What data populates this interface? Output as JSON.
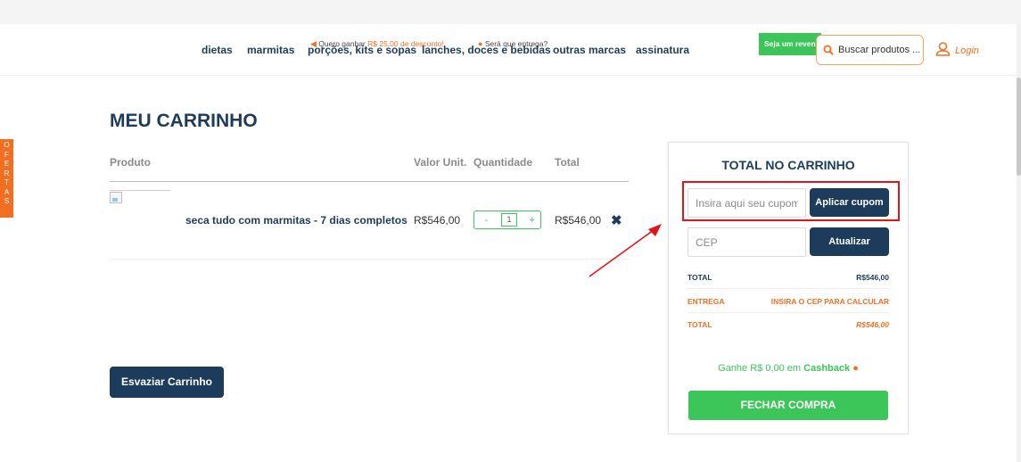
{
  "nav": {
    "items": [
      "dietas",
      "marmitas",
      "porções, kits e sopas",
      "lanches, doces e bebidas",
      "outras marcas",
      "assinatura"
    ],
    "promo_text": "Quero ganhar",
    "promo_highlight": "R$ 25,00 de desconto!",
    "delivery_text": "Será que entrega?",
    "reseller_label": "Seja um revendedor",
    "search_placeholder": "Buscar produtos ...",
    "login_label": "Login"
  },
  "side_tab": {
    "label": "OFERTAS"
  },
  "cart": {
    "title": "MEU CARRINHO",
    "headers": {
      "product": "Produto",
      "unit_price": "Valor Unit.",
      "quantity": "Quantidade",
      "total": "Total"
    },
    "items": [
      {
        "name": "seca tudo com marmitas - 7 dias completos",
        "unit_price": "R$546,00",
        "qty_minus": "-",
        "quantity": "1",
        "qty_plus": "+",
        "total": "R$546,00",
        "remove": "✖"
      }
    ],
    "empty_button": "Esvaziar Carrinho"
  },
  "summary": {
    "title": "TOTAL NO CARRINHO",
    "coupon_placeholder": "Insira aqui seu cupom",
    "coupon_button": "Aplicar cupom",
    "cep_placeholder": "CEP",
    "cep_button": "Atualizar",
    "subtotal_label": "TOTAL",
    "subtotal_value": "R$546,00",
    "shipping_label": "ENTREGA",
    "shipping_value": "INSIRA O CEP PARA CALCULAR",
    "total_label": "TOTAL",
    "total_value": "R$546,00",
    "cashback_prefix": "Ganhe R$ 0,00 em",
    "cashback_word": "Cashback",
    "checkout_button": "FECHAR COMPRA"
  },
  "colors": {
    "navy": "#1d3b5a",
    "orange": "#f26f21",
    "green": "#3cc559",
    "annotation_red": "#e0151b"
  },
  "icons": [
    "megaphone-icon",
    "location-pin-icon",
    "search-icon",
    "user-icon",
    "close-icon",
    "money-bag-icon"
  ]
}
